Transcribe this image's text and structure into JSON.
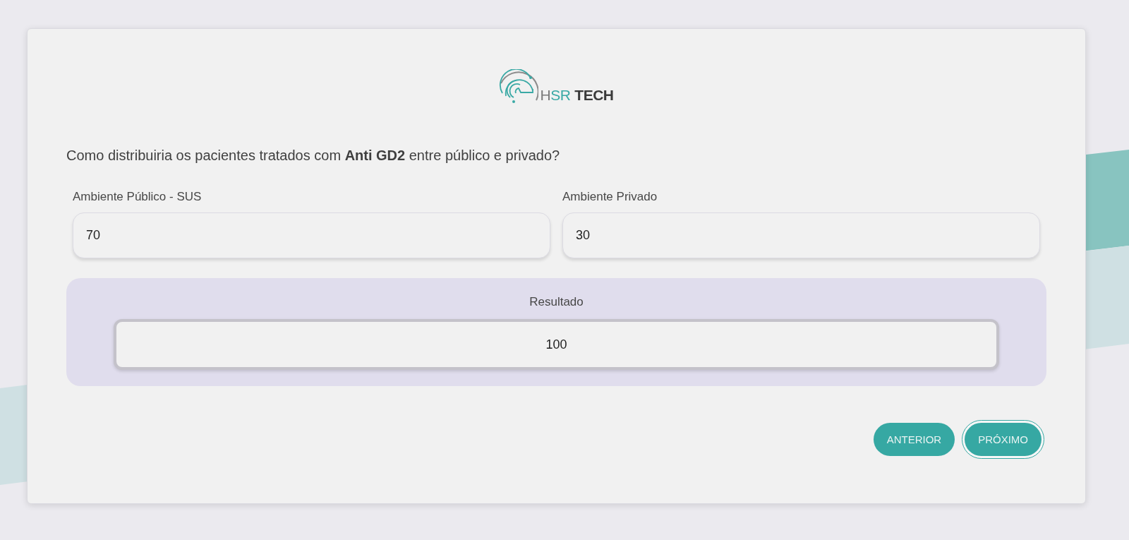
{
  "logo": {
    "brand": [
      "H",
      "SR"
    ],
    "suffix": "TECH"
  },
  "question": "Como distribuiria os pacientes tratados com **Anti GD2** entre público e privado?",
  "fields": [
    {
      "label": "Ambiente Público - SUS",
      "value": "70"
    },
    {
      "label": "Ambiente Privado",
      "value": "30"
    }
  ],
  "result": {
    "label": "Resultado",
    "value": "100"
  },
  "buttons": [
    {
      "label": "ANTERIOR",
      "focused": false
    },
    {
      "label": "PRÓXIMO",
      "focused": true
    }
  ]
}
